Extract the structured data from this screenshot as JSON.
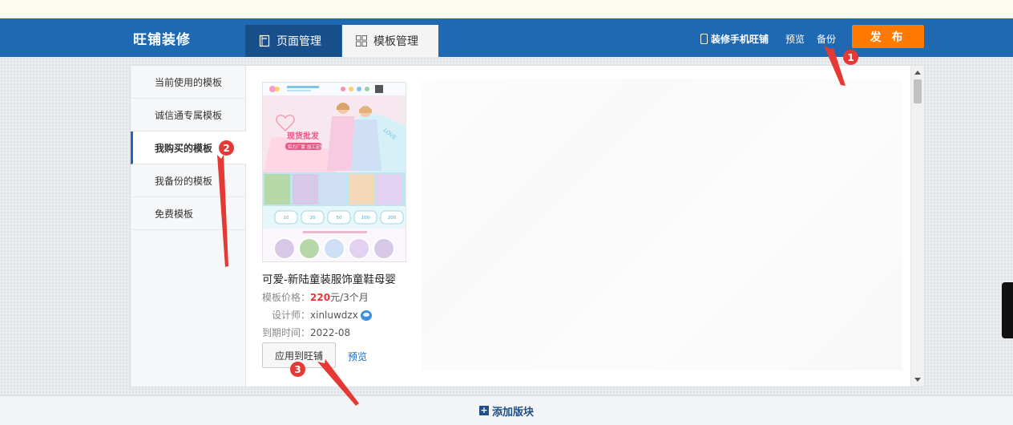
{
  "header": {
    "brand": "旺铺装修",
    "tabs": [
      {
        "label": "页面管理",
        "icon": "page-icon"
      },
      {
        "label": "模板管理",
        "icon": "grid-icon"
      }
    ],
    "links": {
      "mobile": "装修手机旺铺",
      "preview": "预览",
      "backup": "备份"
    },
    "publish_label": "发 布"
  },
  "sidebar": {
    "items": [
      {
        "label": "当前使用的模板"
      },
      {
        "label": "诚信通专属模板"
      },
      {
        "label": "我购买的模板"
      },
      {
        "label": "我备份的模板"
      },
      {
        "label": "免费模板"
      }
    ],
    "active_index": 2
  },
  "template_card": {
    "title": "可爱-新陆童装服饰童鞋母婴",
    "price_label": "模板价格：",
    "price_value": "220",
    "price_unit": "元/3个月",
    "designer_label": "设计师：",
    "designer_value": "xinluwdzx",
    "expiry_label": "到期时间：",
    "expiry_value": "2022-08",
    "apply_label": "应用到旺铺",
    "preview_label": "预览",
    "thumbnail": {
      "banner_big_text": "现货批发",
      "banner_small_text": "实力厂家 加工定制",
      "banner_love_text": "LOVE",
      "coupon_values": [
        "10",
        "20",
        "50",
        "100",
        "200"
      ]
    }
  },
  "footer": {
    "add_block_label": "添加版块"
  },
  "annotations": {
    "markers": [
      "1",
      "2",
      "3"
    ],
    "color": "#e53935"
  },
  "colors": {
    "header_bg": "#1f68b2",
    "publish_bg": "#ff7a00",
    "price": "#e33333",
    "link": "#1f68b2"
  }
}
